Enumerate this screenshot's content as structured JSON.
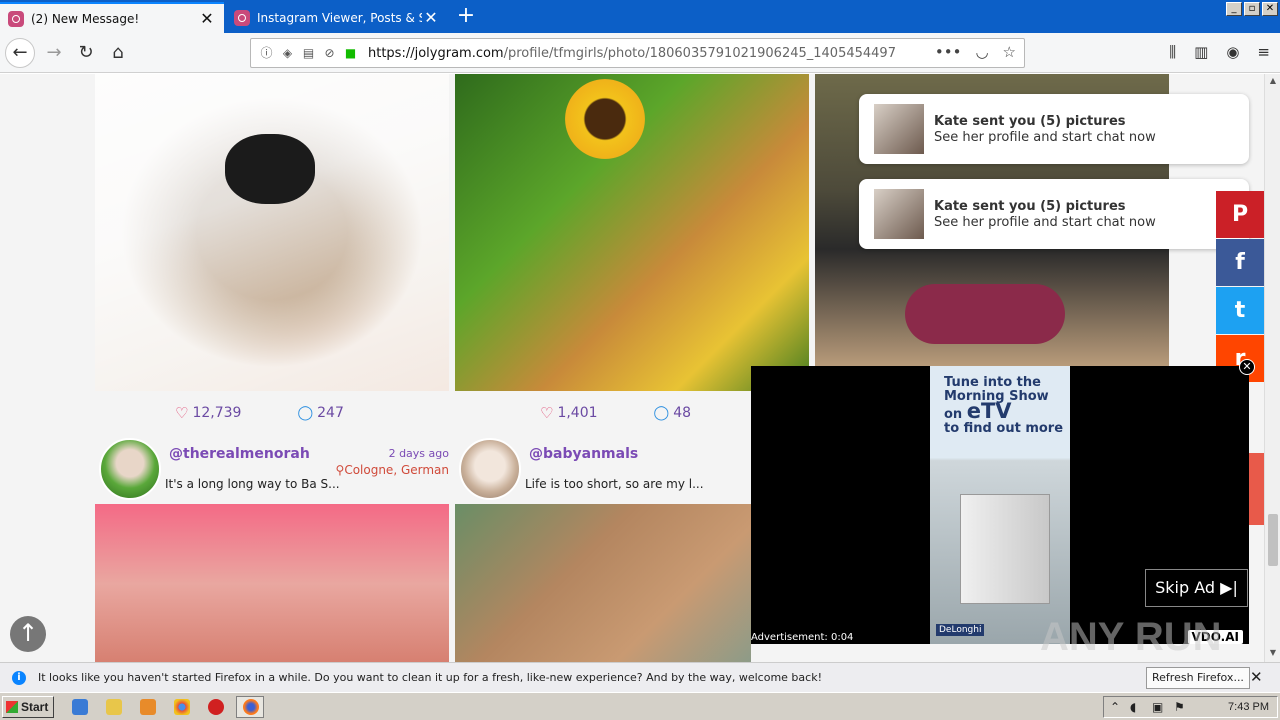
{
  "browser": {
    "tabs": [
      {
        "label": "(2) New Message!",
        "close": "✕"
      },
      {
        "label": "Instagram Viewer, Posts & Story D",
        "close": "✕"
      }
    ],
    "new_tab": "+",
    "window_controls": [
      "_",
      "▫",
      "✕"
    ],
    "url_domain": "https://jolygram.com",
    "url_path": "/profile/tfmgirls/photo/1806035791021906245_1405454497",
    "url_more": "•••"
  },
  "posts": [
    {
      "likes": "12,739",
      "comments": "247",
      "username": "@therealmenorah",
      "date": "2 days ago",
      "location": "Cologne, German",
      "caption": "It's a long long way to Ba S..."
    },
    {
      "likes": "1,401",
      "comments": "48",
      "username": "@babyanmals",
      "caption": "Life is too short, so are my l..."
    }
  ],
  "notifications": [
    {
      "title": "Kate sent you (5) pictures",
      "subtitle": "See her profile and start chat now"
    },
    {
      "title": "Kate sent you (5) pictures",
      "subtitle": "See her profile and start chat now"
    }
  ],
  "social": [
    {
      "icon": "pinterest-icon",
      "glyph": "P",
      "color": "#cb2027"
    },
    {
      "icon": "facebook-icon",
      "glyph": "f",
      "color": "#3b5998"
    },
    {
      "icon": "twitter-icon",
      "glyph": "t",
      "color": "#1da1f2"
    },
    {
      "icon": "reddit-icon",
      "glyph": "r",
      "color": "#ff4500"
    }
  ],
  "video_ad": {
    "line1": "Tune into the",
    "line2": "Morning Show",
    "line3": "on",
    "line3_big": "eTV",
    "line4": "to find out more",
    "brand": "DeLonghi",
    "label": "Advertisement: 0:04",
    "skip": "Skip Ad",
    "provider": "VDO.AI",
    "close": "✕"
  },
  "notification_bar": {
    "message": "It looks like you haven't started Firefox in a while. Do you want to clean it up for a fresh, like-new experience? And by the way, welcome back!",
    "button": "Refresh Firefox...",
    "close": "✕"
  },
  "taskbar": {
    "start": "Start",
    "clock": "7:43 PM"
  },
  "watermark": "ANY RUN"
}
